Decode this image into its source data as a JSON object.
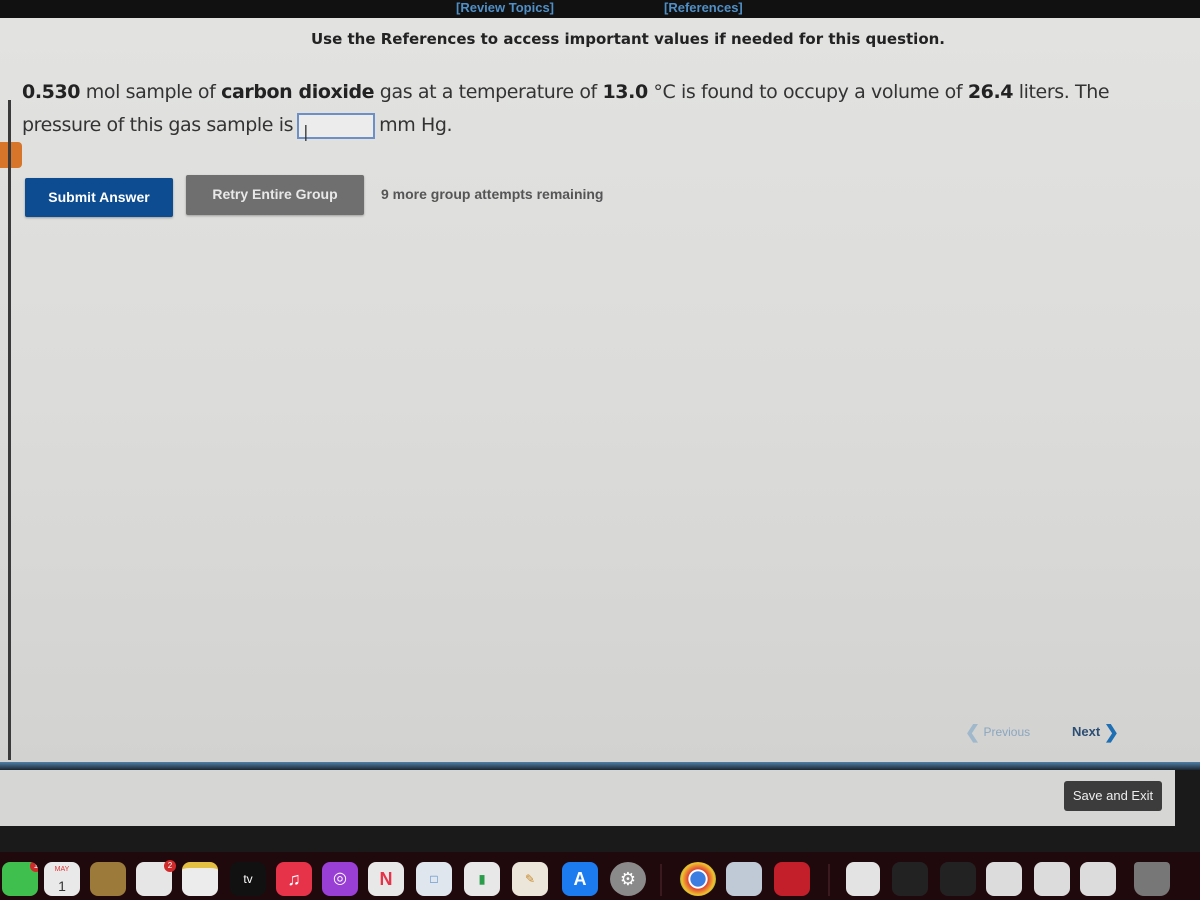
{
  "header": {
    "review_topics": "[Review Topics]",
    "references": "[References]"
  },
  "notice": "Use the References to access important values if needed for this question.",
  "question": {
    "amount": "0.530",
    "text_1": " mol sample of ",
    "substance": "carbon dioxide",
    "text_2": " gas at a temperature of ",
    "temperature": "13.0",
    "text_3": " °C is found to occupy a volume of ",
    "volume": "26.4",
    "text_4": " liters. The pressure of this gas sample is",
    "answer_value": "|",
    "unit": "mm Hg."
  },
  "actions": {
    "submit_label": "Submit Answer",
    "retry_label": "Retry Entire Group",
    "attempts_text": "9 more group attempts remaining"
  },
  "navigation": {
    "previous_label": "Previous",
    "next_label": "Next",
    "save_exit_label": "Save and Exit"
  },
  "dock": {
    "items": [
      {
        "name": "facetime",
        "badge": "1",
        "color": "#3fbf4d"
      },
      {
        "name": "calendar",
        "month": "MAY",
        "day": "1",
        "color": "#e9e9e9"
      },
      {
        "name": "contacts",
        "color": "#9b7a3a"
      },
      {
        "name": "reminders",
        "badge": "2",
        "color": "#e6e6e6"
      },
      {
        "name": "notes",
        "color": "#ececec"
      },
      {
        "name": "apple-tv",
        "label": "tv",
        "color": "#111111"
      },
      {
        "name": "music",
        "color": "#e6334a"
      },
      {
        "name": "podcasts",
        "color": "#9a3fd6"
      },
      {
        "name": "news",
        "color": "#e8e8e8"
      },
      {
        "name": "keynote",
        "color": "#dfe6ee"
      },
      {
        "name": "numbers",
        "color": "#e8e8e8"
      },
      {
        "name": "pages",
        "color": "#ece6da"
      },
      {
        "name": "app-store",
        "color": "#1d7bf0"
      },
      {
        "name": "system-preferences",
        "color": "#8a8a8a"
      },
      {
        "name": "chrome",
        "color": "#e8e8e8"
      },
      {
        "name": "preview",
        "color": "#bfcad6"
      },
      {
        "name": "photo-booth",
        "color": "#c21f2a"
      },
      {
        "name": "document-1",
        "color": "#e3e3e3"
      },
      {
        "name": "document-2",
        "color": "#222222"
      },
      {
        "name": "document-3",
        "color": "#222222"
      },
      {
        "name": "document-4",
        "color": "#dcdcdc"
      },
      {
        "name": "document-5",
        "color": "#dcdcdc"
      },
      {
        "name": "document-6",
        "color": "#dcdcdc"
      },
      {
        "name": "trash",
        "color": "#777777"
      }
    ]
  },
  "colors": {
    "link": "#4f8fc6",
    "submit": "#0d4c91",
    "retry": "#6f6f6f",
    "flag": "#d7762a",
    "input_border": "#6c8fc8"
  }
}
